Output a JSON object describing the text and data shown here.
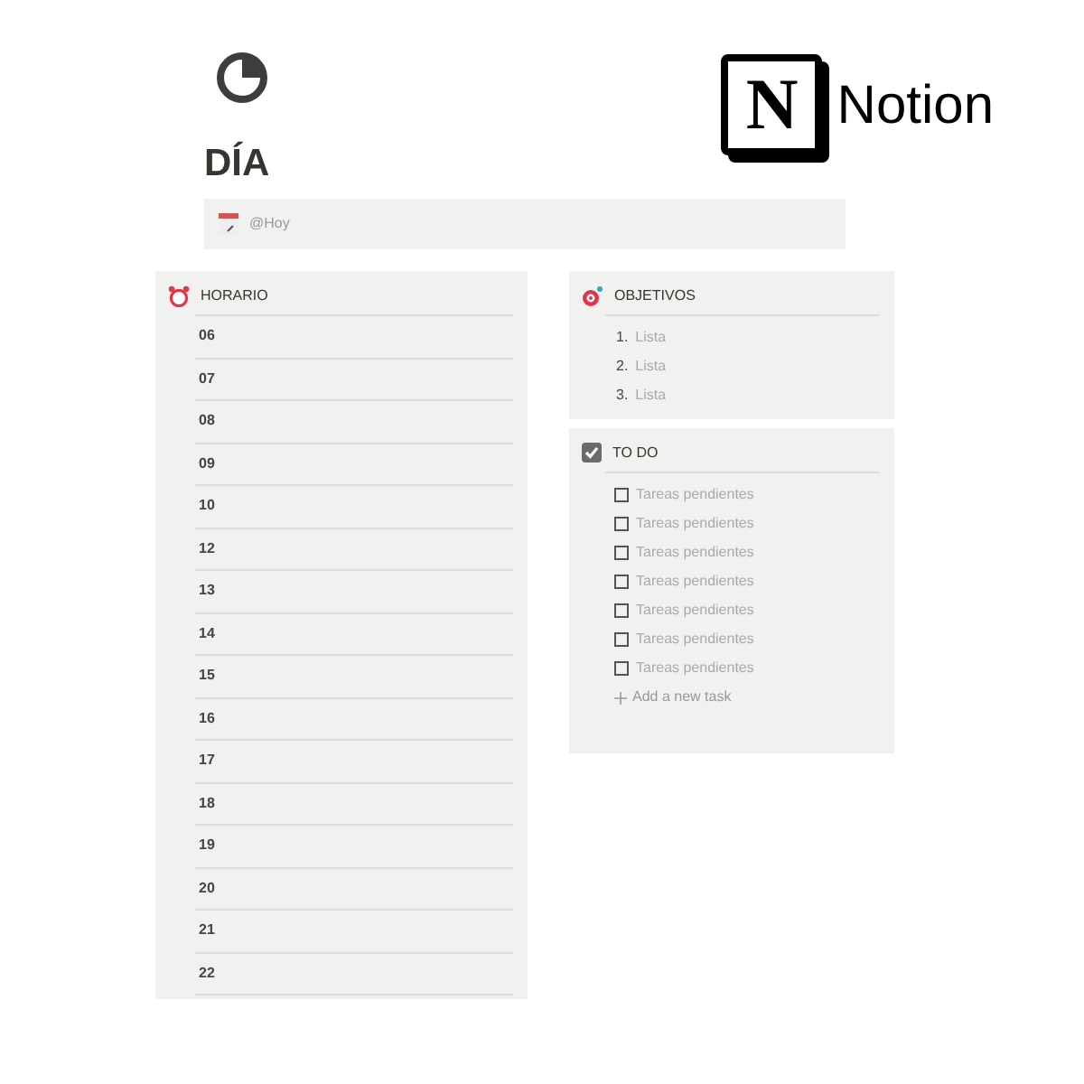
{
  "logo": {
    "mark": "N",
    "name": "Notion"
  },
  "page": {
    "title": "DÍA",
    "date": "@Hoy"
  },
  "horario": {
    "title": "HORARIO",
    "hours": [
      "06",
      "07",
      "08",
      "09",
      "10",
      "12",
      "13",
      "14",
      "15",
      "16",
      "17",
      "18",
      "19",
      "20",
      "21",
      "22"
    ]
  },
  "objetivos": {
    "title": "OBJETIVOS",
    "items": [
      {
        "number": "1.",
        "text": "Lista"
      },
      {
        "number": "2.",
        "text": "Lista"
      },
      {
        "number": "3.",
        "text": "Lista"
      }
    ]
  },
  "todo": {
    "title": "TO DO",
    "tasks": [
      {
        "text": "Tareas pendientes",
        "checked": false
      },
      {
        "text": "Tareas pendientes",
        "checked": false
      },
      {
        "text": "Tareas pendientes",
        "checked": false
      },
      {
        "text": "Tareas pendientes",
        "checked": false
      },
      {
        "text": "Tareas pendientes",
        "checked": false
      },
      {
        "text": "Tareas pendientes",
        "checked": false
      },
      {
        "text": "Tareas pendientes",
        "checked": false
      }
    ],
    "add_label": "Add a new task"
  }
}
